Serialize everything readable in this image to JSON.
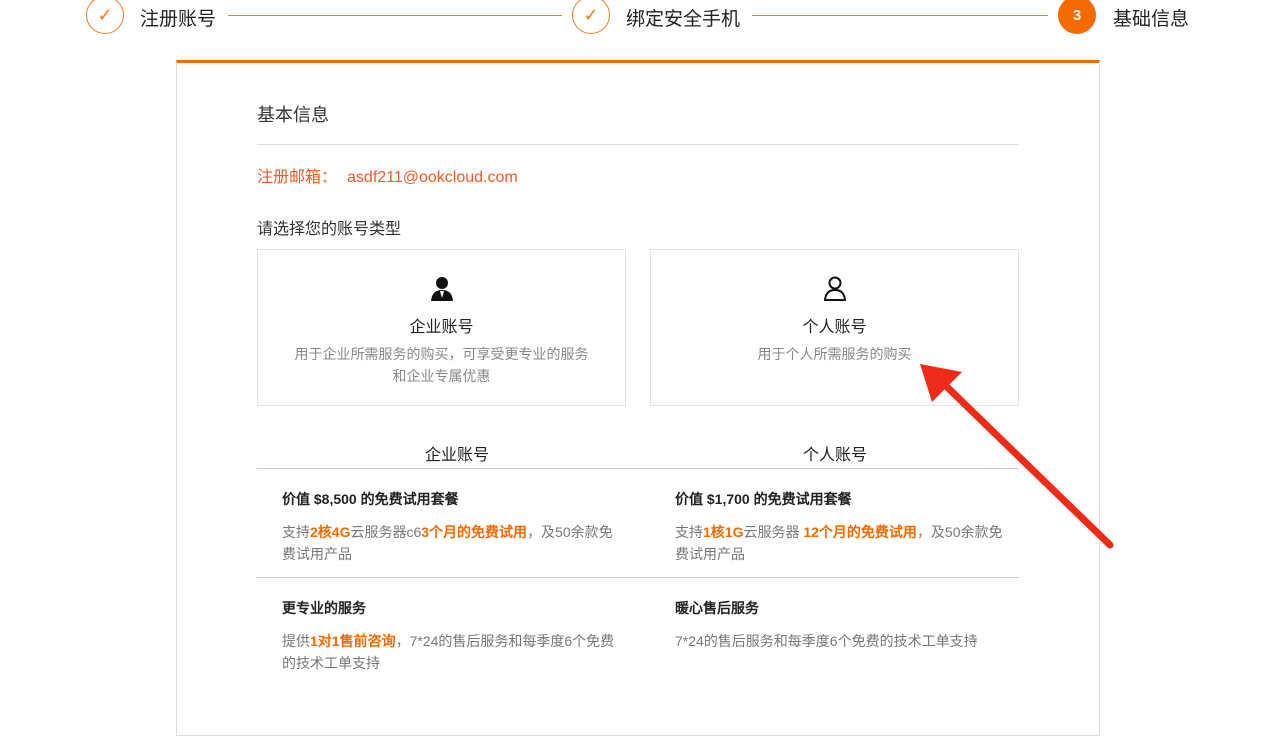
{
  "steps": [
    {
      "label": "注册账号",
      "state": "done"
    },
    {
      "label": "绑定安全手机",
      "state": "done"
    },
    {
      "label": "基础信息",
      "number": "3",
      "state": "active"
    }
  ],
  "title": "基本信息",
  "email": {
    "label": "注册邮箱：",
    "value": "asdf211@ookcloud.com"
  },
  "choose_label": "请选择您的账号类型",
  "types": [
    {
      "name": "企业账号",
      "desc1": "用于企业所需服务的购买，可享受更专业的服务",
      "desc2": "和企业专属优惠"
    },
    {
      "name": "个人账号",
      "desc1": "用于个人所需服务的购买",
      "desc2": ""
    }
  ],
  "compare": {
    "enterprise": {
      "header": "企业账号",
      "s1": {
        "title": "价值 $8,500 的免费试用套餐",
        "p1": "支持",
        "h1": "2核4G",
        "p2": "云服务器c6",
        "h2": "3个月的免费试用",
        "p3": "，及50余款免费试用产品"
      },
      "s2": {
        "title": "更专业的服务",
        "p1": "提供",
        "h1": "1对1售前咨询",
        "p2": "，7*24的售后服务和每季度6个免费的技术工单支持"
      }
    },
    "personal": {
      "header": "个人账号",
      "s1": {
        "title": "价值 $1,700 的免费试用套餐",
        "p1": "支持",
        "h1": "1核1G",
        "p2": "云服务器 ",
        "h2": "12个月的免费试用",
        "p3": "，及50余款免费试用产品"
      },
      "s2": {
        "title": "暖心售后服务",
        "p1": "7*24的售后服务和每季度6个免费的技术工单支持"
      }
    }
  },
  "colors": {
    "accent": "#f56a00",
    "email": "#f05a28",
    "arrow": "#f02a18"
  }
}
